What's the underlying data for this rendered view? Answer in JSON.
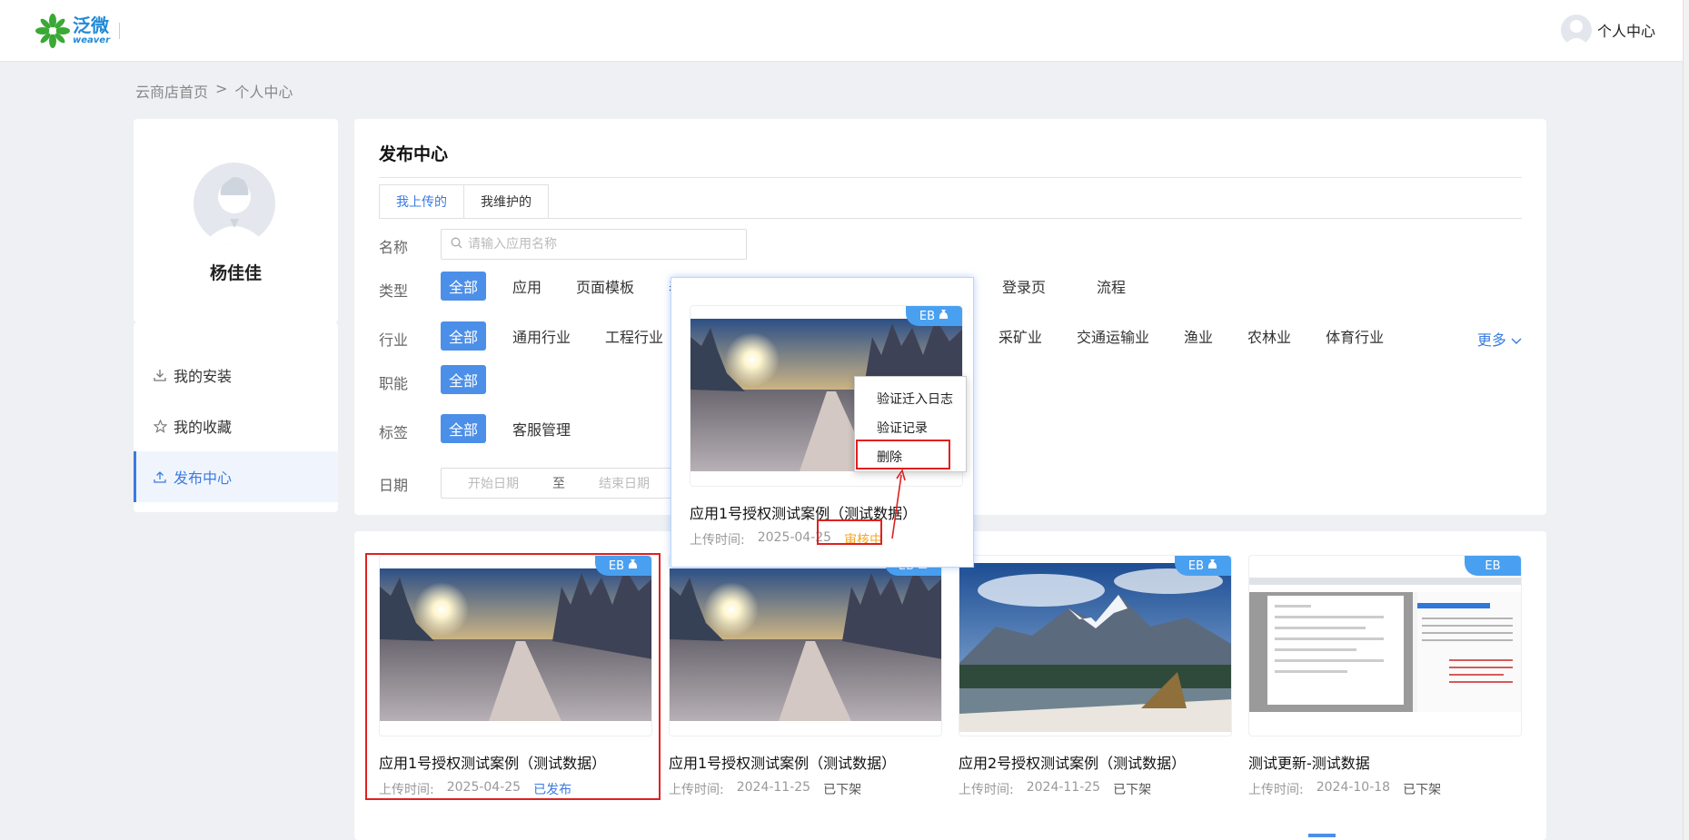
{
  "header": {
    "logo_cn": "泛微",
    "logo_en": "weaver",
    "user_label": "个人中心"
  },
  "breadcrumb": {
    "home": "云商店首页",
    "sep": ">",
    "current": "个人中心"
  },
  "profile": {
    "name": "杨佳佳"
  },
  "side_menu": {
    "items": [
      {
        "label": "我的安装",
        "icon": "download-icon"
      },
      {
        "label": "我的收藏",
        "icon": "star-icon"
      },
      {
        "label": "发布中心",
        "icon": "upload-icon",
        "active": true
      }
    ]
  },
  "main": {
    "title": "发布中心",
    "tabs": [
      {
        "label": "我上传的",
        "active": true
      },
      {
        "label": "我维护的"
      }
    ],
    "name_label": "名称",
    "search_placeholder": "请输入应用名称",
    "type_label": "类型",
    "type_chips": [
      "全部",
      "应用",
      "页面模板",
      "表",
      "登录页",
      "流程"
    ],
    "industry_label": "行业",
    "industry_chips": [
      "全部",
      "通用行业",
      "工程行业",
      "采矿业",
      "交通运输业",
      "渔业",
      "农林业",
      "体育行业"
    ],
    "more_label": "更多",
    "function_label": "职能",
    "function_chips": [
      "全部"
    ],
    "tag_label": "标签",
    "tag_chips": [
      "全部",
      "客服管理"
    ],
    "date_label": "日期",
    "date_start": "开始日期",
    "date_to": "至",
    "date_end": "结束日期"
  },
  "apps": [
    {
      "title": "应用1号授权测试案例（测试数据）",
      "upload_label": "上传时间:",
      "date": "2025-04-25",
      "status": "已发布",
      "badge": "EB"
    },
    {
      "title": "应用1号授权测试案例（测试数据）",
      "upload_label": "上传时间:",
      "date": "2024-11-25",
      "status": "已下架",
      "badge": "EB"
    },
    {
      "title": "应用2号授权测试案例（测试数据）",
      "upload_label": "上传时间:",
      "date": "2024-11-25",
      "status": "已下架",
      "badge": "EB"
    },
    {
      "title": "测试更新-测试数据",
      "upload_label": "上传时间:",
      "date": "2024-10-18",
      "status": "已下架",
      "badge": "EB"
    }
  ],
  "popup": {
    "title": "应用1号授权测试案例（测试数据）",
    "upload_label": "上传时间:",
    "date": "2025-04-25",
    "status": "审核中",
    "badge": "EB",
    "menu": [
      "验证迁入日志",
      "验证记录",
      "删除"
    ]
  },
  "colors": {
    "accent": "#3a7be0",
    "chip_selected": "#4c8fe8",
    "badge": "#4aa0f0",
    "review": "#f5a623",
    "highlight_frame": "#e02020"
  }
}
